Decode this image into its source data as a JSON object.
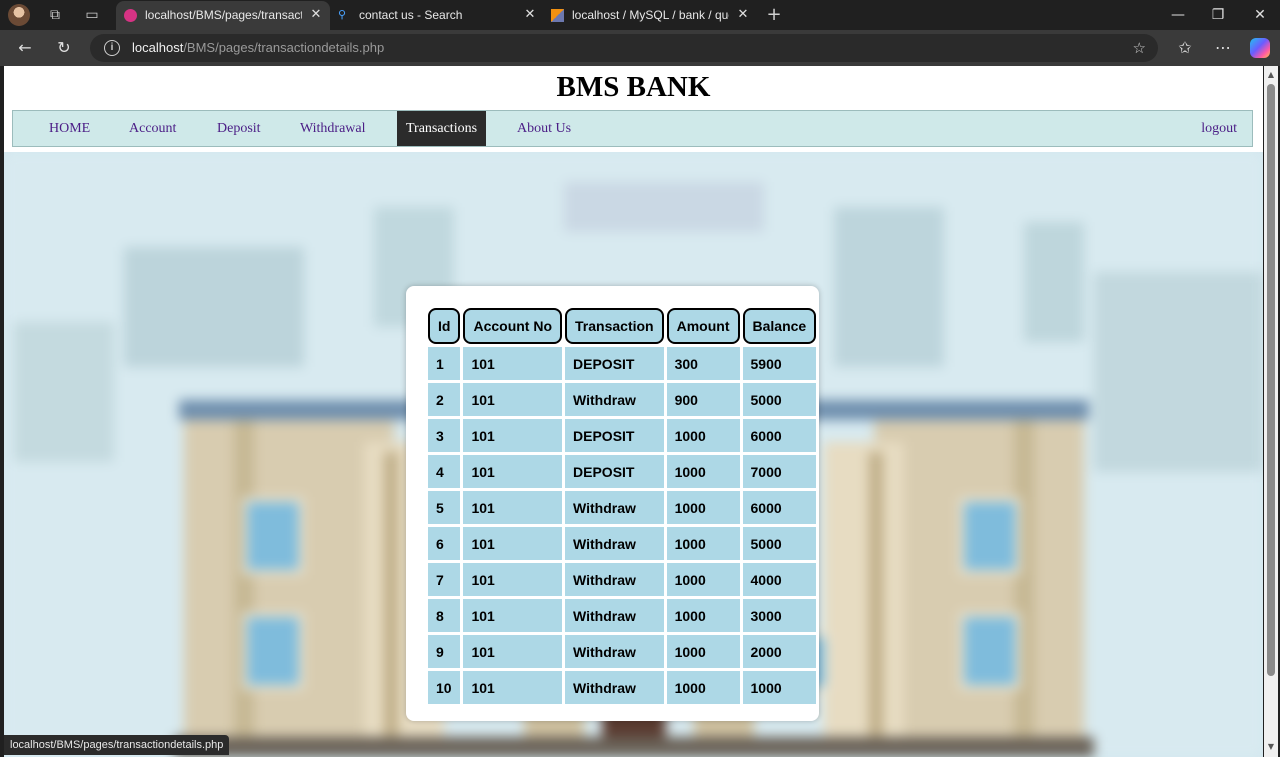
{
  "browser": {
    "tabs": [
      {
        "title": "localhost/BMS/pages/transactiondetails.php",
        "active": true
      },
      {
        "title": "contact us - Search",
        "active": false
      },
      {
        "title": "localhost / MySQL / bank / queries",
        "active": false
      }
    ],
    "url_host": "localhost",
    "url_path": "/BMS/pages/transactiondetails.php",
    "status_url": "localhost/BMS/pages/transactiondetails.php",
    "icons": {
      "workspaces": "workspaces-icon",
      "tab_actions": "tab-actions-icon",
      "close": "close-icon",
      "new_tab": "plus-icon",
      "minimize": "minimize-icon",
      "restore": "restore-icon",
      "close_window": "close-window-icon",
      "back": "back-arrow-icon",
      "refresh": "refresh-icon",
      "site_info": "info-icon",
      "favorite": "star-icon",
      "favorites": "favorites-icon",
      "menu": "more-icon",
      "copilot": "copilot-icon"
    }
  },
  "site": {
    "title": "BMS BANK",
    "nav": [
      "HOME",
      "Account",
      "Deposit",
      "Withdrawal",
      "Transactions",
      "About Us"
    ],
    "active_nav": "Transactions",
    "logout": "logout"
  },
  "table": {
    "headers": [
      "Id",
      "Account No",
      "Transaction",
      "Amount",
      "Balance"
    ],
    "rows": [
      [
        "1",
        "101",
        "DEPOSIT",
        "300",
        "5900"
      ],
      [
        "2",
        "101",
        "Withdraw",
        "900",
        "5000"
      ],
      [
        "3",
        "101",
        "DEPOSIT",
        "1000",
        "6000"
      ],
      [
        "4",
        "101",
        "DEPOSIT",
        "1000",
        "7000"
      ],
      [
        "5",
        "101",
        "Withdraw",
        "1000",
        "6000"
      ],
      [
        "6",
        "101",
        "Withdraw",
        "1000",
        "5000"
      ],
      [
        "7",
        "101",
        "Withdraw",
        "1000",
        "4000"
      ],
      [
        "8",
        "101",
        "Withdraw",
        "1000",
        "3000"
      ],
      [
        "9",
        "101",
        "Withdraw",
        "1000",
        "2000"
      ],
      [
        "10",
        "101",
        "Withdraw",
        "1000",
        "1000"
      ]
    ]
  },
  "colors": {
    "nav_bg": "#cfe9e9",
    "nav_link": "#4b1d86",
    "nav_active_bg": "#2b2b2b",
    "table_cell": "#add8e6"
  }
}
